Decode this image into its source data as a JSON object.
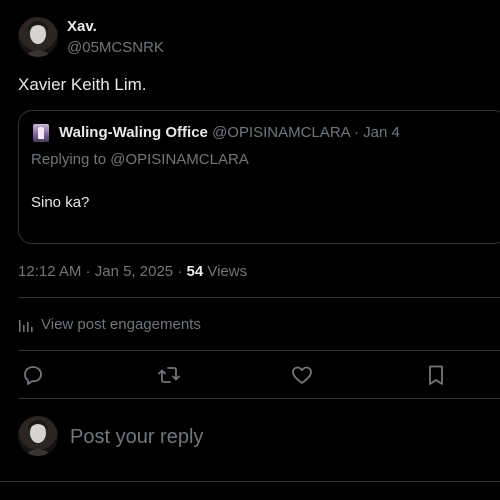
{
  "author": {
    "name": "Xav.",
    "handle": "@05MCSNRK"
  },
  "post": {
    "text": "Xavier Keith Lim."
  },
  "quote": {
    "name": "Waling-Waling Office",
    "handle": "@OPISINAMCLARA",
    "dot": " · ",
    "date": "Jan 4",
    "replying_prefix": "Replying to ",
    "replying_handle": "@OPISINAMCLARA",
    "text": "Sino ka?"
  },
  "meta": {
    "time": "12:12 AM",
    "sep1": " · ",
    "date": "Jan 5, 2025",
    "sep2": " · ",
    "views_count": "54",
    "views_label": " Views"
  },
  "engagements": {
    "label": "View post engagements",
    "icon": "analytics-icon"
  },
  "actions": {
    "reply": "reply-icon",
    "repost": "repost-icon",
    "like": "heart-icon",
    "bookmark": "bookmark-icon"
  },
  "reply_box": {
    "placeholder": "Post your reply"
  },
  "colors": {
    "background": "#000000",
    "text": "#e7e9ea",
    "muted": "#71767b",
    "border": "#2f3336"
  }
}
